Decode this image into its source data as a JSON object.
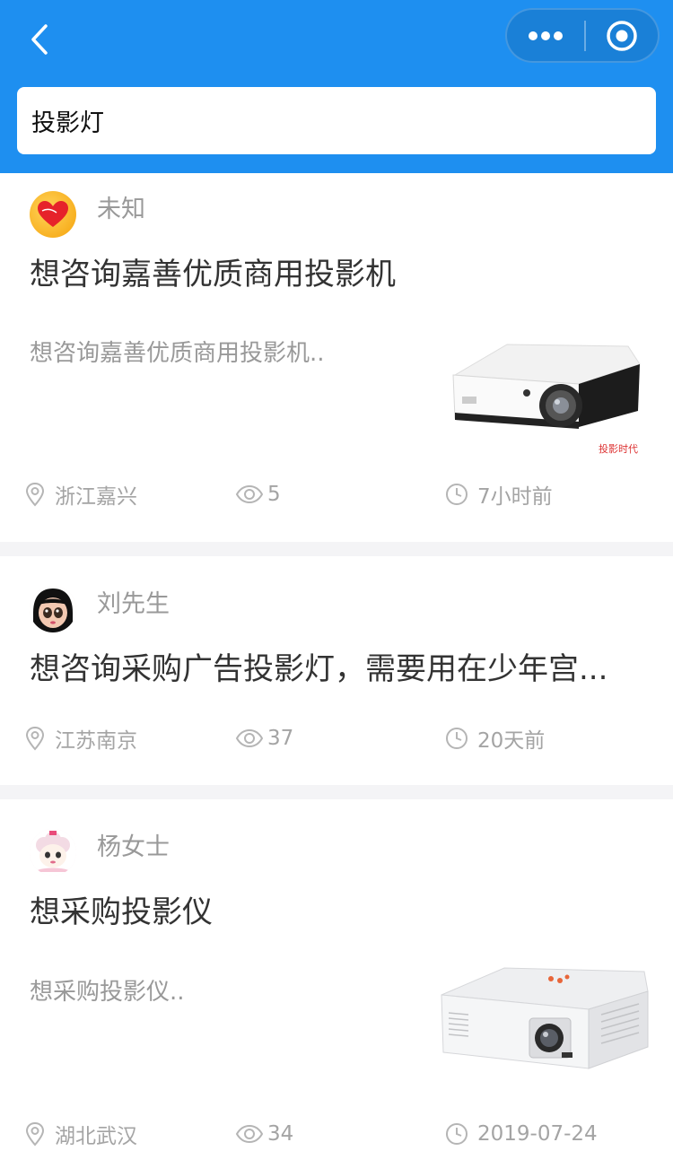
{
  "header": {
    "search_value": "投影灯"
  },
  "posts": [
    {
      "user": "未知",
      "title": "想咨询嘉善优质商用投影机",
      "description": "想咨询嘉善优质商用投影机..",
      "location": "浙江嘉兴",
      "views": "5",
      "time": "7小时前",
      "thumbnail_watermark": "投影时代"
    },
    {
      "user": "刘先生",
      "title": "想咨询采购广告投影灯，需要用在少年宫...",
      "location": "江苏南京",
      "views": "37",
      "time": "20天前"
    },
    {
      "user": "杨女士",
      "title": "想采购投影仪",
      "description": "想采购投影仪..",
      "location": "湖北武汉",
      "views": "34",
      "time": "2019-07-24"
    }
  ],
  "colors": {
    "header_bg": "#1e8ff0",
    "page_bg": "#f4f4f6",
    "meta_text": "#a4a4a4"
  }
}
